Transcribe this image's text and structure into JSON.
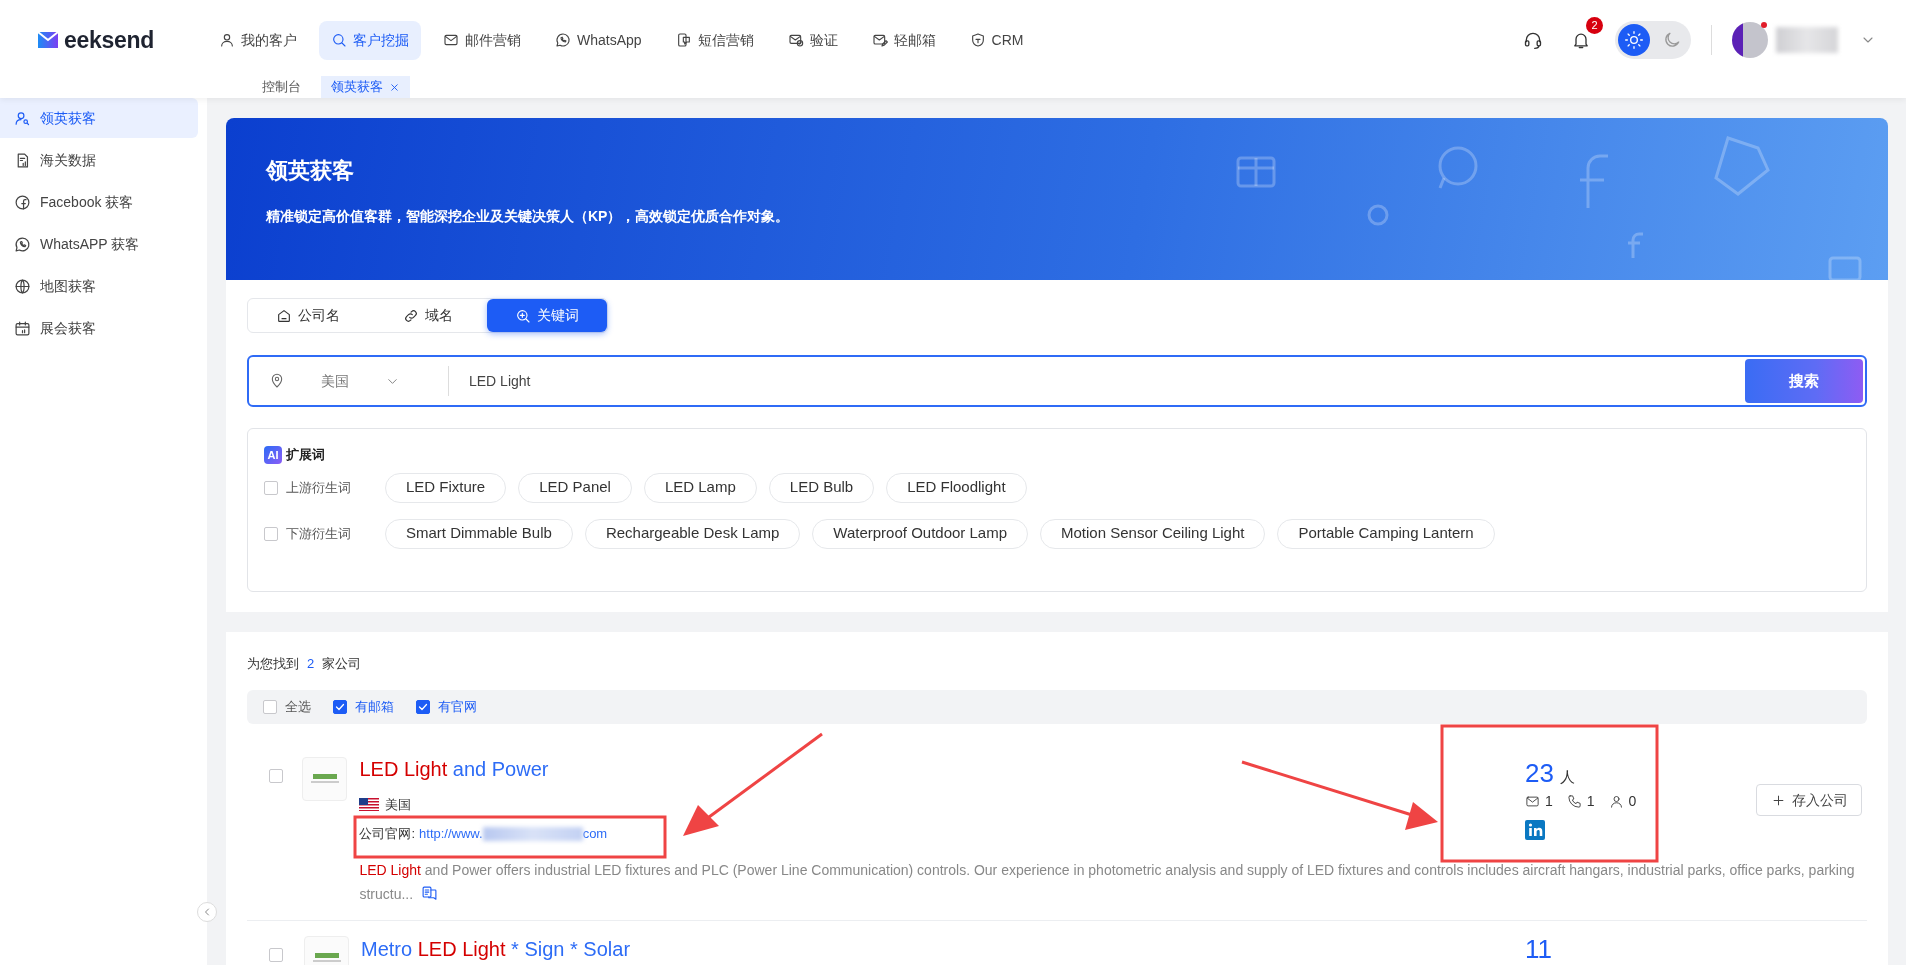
{
  "logo": {
    "text": "eeksend"
  },
  "top_nav": [
    {
      "label": "我的客户",
      "kind": "user",
      "selected": false
    },
    {
      "label": "客户挖掘",
      "kind": "search",
      "selected": true
    },
    {
      "label": "邮件营销",
      "kind": "mail",
      "selected": false
    },
    {
      "label": "WhatsApp",
      "kind": "whatsapp",
      "selected": false
    },
    {
      "label": "短信营销",
      "kind": "sms",
      "selected": false
    },
    {
      "label": "验证",
      "kind": "verify",
      "selected": false
    },
    {
      "label": "轻邮箱",
      "kind": "lightmail",
      "selected": false
    },
    {
      "label": "CRM",
      "kind": "shield",
      "selected": false
    }
  ],
  "page_tabs": [
    {
      "label": "控制台",
      "selected": false,
      "closable": false
    },
    {
      "label": "领英获客",
      "selected": true,
      "closable": true
    }
  ],
  "header_tools": {
    "notification_badge": "2",
    "theme_options": [
      {
        "kind": "sun",
        "selected": true
      },
      {
        "kind": "moon",
        "selected": false
      }
    ]
  },
  "sidebar": {
    "items": [
      {
        "label": "领英获客",
        "kind": "usersearch",
        "selected": true
      },
      {
        "label": "海关数据",
        "kind": "doc",
        "selected": false
      },
      {
        "label": "Facebook 获客",
        "kind": "facebook",
        "selected": false
      },
      {
        "label": "WhatsAPP 获客",
        "kind": "whatsapp",
        "selected": false
      },
      {
        "label": "地图获客",
        "kind": "globe",
        "selected": false
      },
      {
        "label": "展会获客",
        "kind": "calendar",
        "selected": false
      }
    ]
  },
  "banner": {
    "title": "领英获客",
    "subtitle": "精准锁定高价值客群，智能深挖企业及关键决策人（KP），高效锁定优质合作对象。"
  },
  "search": {
    "modes": [
      {
        "label": "公司名",
        "kind": "home",
        "selected": false
      },
      {
        "label": "域名",
        "kind": "link",
        "selected": false
      },
      {
        "label": "关键词",
        "kind": "searchplus",
        "selected": true
      }
    ],
    "location": "美国",
    "query": "LED Light",
    "button": "搜索"
  },
  "expansion": {
    "badge": "AI",
    "title": "扩展词",
    "groups": [
      {
        "label": "上游衍生词",
        "checked": false,
        "terms": [
          "LED Fixture",
          "LED Panel",
          "LED Lamp",
          "LED Bulb",
          "LED Floodlight"
        ]
      },
      {
        "label": "下游衍生词",
        "checked": false,
        "terms": [
          "Smart Dimmable Bulb",
          "Rechargeable Desk Lamp",
          "Waterproof Outdoor Lamp",
          "Motion Sensor Ceiling Light",
          "Portable Camping Lantern"
        ]
      }
    ]
  },
  "results": {
    "prefix": "为您找到",
    "count": "2",
    "suffix": "家公司",
    "filters": [
      {
        "label": "全选",
        "checked": false
      },
      {
        "label": "有邮箱",
        "checked": true
      },
      {
        "label": "有官网",
        "checked": true
      }
    ],
    "companies": [
      {
        "checked": false,
        "title_parts": [
          {
            "text": "LED Light",
            "highlight": true
          },
          {
            "text": " and Power",
            "highlight": false
          }
        ],
        "country": "美国",
        "website_label": "公司官网:",
        "website_start": "http://www.",
        "website_end": "com",
        "description_parts": [
          {
            "text": "LED Light",
            "highlight": true
          },
          {
            "text": " and Power offers industrial LED fixtures and PLC (Power Line Communication) controls. Our experience in photometric analysis and supply of LED fixtures and controls includes aircraft hangars, industrial parks, office parks, parking structu...",
            "highlight": false
          }
        ],
        "people_count": "23",
        "people_unit": "人",
        "emails": "1",
        "phones": "1",
        "contacts": "0",
        "linkedin": true,
        "save_button": "存入公司"
      },
      {
        "checked": false,
        "title_parts": [
          {
            "text": "Metro ",
            "highlight": false
          },
          {
            "text": "LED Light",
            "highlight": true
          },
          {
            "text": " * Sign * Solar",
            "highlight": false
          }
        ],
        "people_count": "11"
      }
    ]
  }
}
